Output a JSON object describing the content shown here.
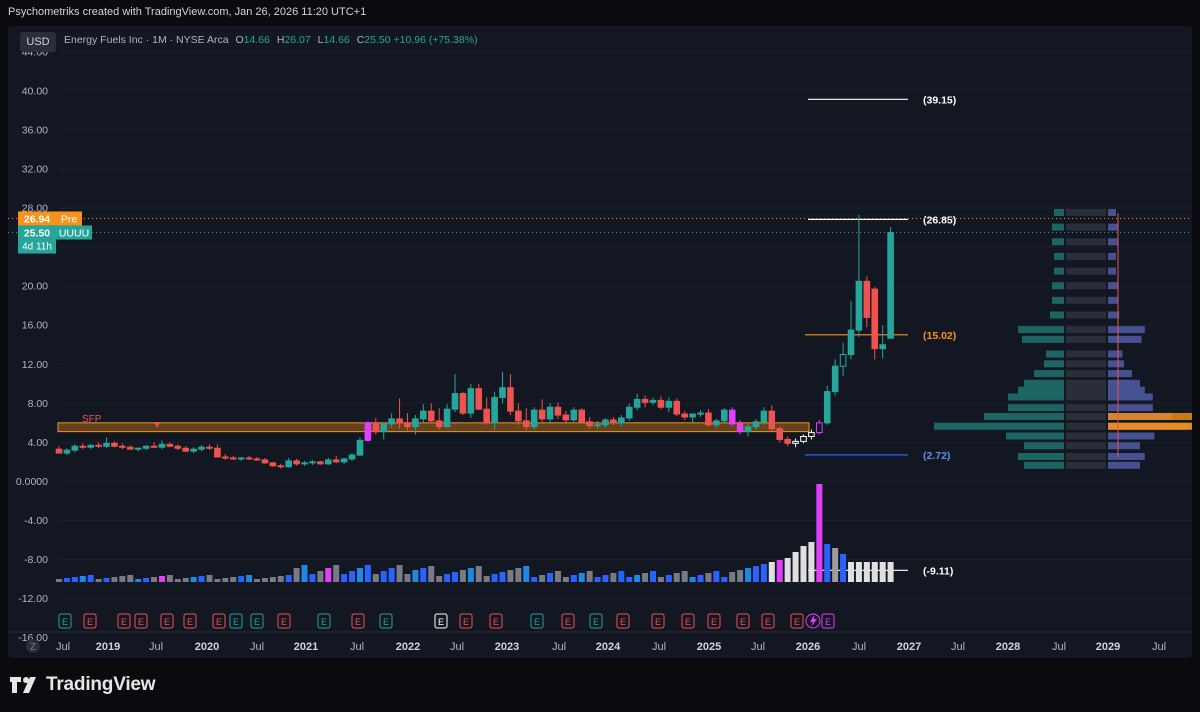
{
  "header": {
    "attribution": "Psychometriks created with TradingView.com, Jan 26, 2026 11:20 UTC+1"
  },
  "toolbar": {
    "currency": "USD"
  },
  "legend": {
    "symbol": "Energy Fuels Inc · 1M · NYSE Arca",
    "o_label": "O",
    "o_value": "14.66",
    "h_label": "H",
    "h_value": "26.07",
    "l_label": "L",
    "l_value": "14.66",
    "c_label": "C",
    "c_value": "25.50",
    "change": "+10.96 (+75.38%)"
  },
  "price_tags": [
    {
      "value": "26.94",
      "label": "Pre",
      "color": "#f7931a"
    },
    {
      "value": "25.50",
      "label": "UUUU",
      "color": "#26a69a",
      "sub": "4d 11h"
    }
  ],
  "zone_label": "SFP",
  "levels": [
    {
      "label": "(39.15)",
      "value": 39.15,
      "color": "#ffffff"
    },
    {
      "label": "(26.85)",
      "value": 26.85,
      "color": "#ffffff"
    },
    {
      "label": "(15.02)",
      "value": 15.02,
      "color": "#f7931a"
    },
    {
      "label": "(2.72)",
      "value": 2.72,
      "color": "#2962ff"
    },
    {
      "label": "(-9.11)",
      "value": -9.11,
      "color": "#ffffff"
    }
  ],
  "earnings_markers": [
    "E",
    "E",
    "E",
    "E",
    "E",
    "E",
    "E",
    "E",
    "E",
    "E",
    "E",
    "E",
    "E",
    "E",
    "E",
    "E",
    "E",
    "E",
    "E",
    "E",
    "E",
    "E",
    "E",
    "E",
    "E",
    "E",
    "E",
    "E",
    "E",
    "E",
    "E",
    "E"
  ],
  "footer": {
    "zoom_label": "Z",
    "brand": "TradingView"
  },
  "colors": {
    "up": "#26a69a",
    "down": "#ef5350",
    "background": "#131722",
    "zone": "#f7931a",
    "magenta": "#e040fb"
  },
  "chart_data": {
    "type": "candlestick",
    "title": "Energy Fuels Inc · 1M · NYSE Arca",
    "y_axis_ticks": [
      "44.00",
      "40.00",
      "36.00",
      "32.00",
      "28.00",
      "24.00",
      "20.00",
      "16.00",
      "12.00",
      "8.00",
      "4.00",
      "0.0000",
      "-4.00",
      "-8.00",
      "-12.00",
      "-16.00"
    ],
    "ylim": [
      -16,
      44
    ],
    "x_axis_ticks": [
      "Jul",
      "2019",
      "Jul",
      "2020",
      "Jul",
      "2021",
      "Jul",
      "2022",
      "Jul",
      "2023",
      "Jul",
      "2024",
      "Jul",
      "2025",
      "Jul",
      "2026",
      "Jul",
      "2027",
      "Jul",
      "2028",
      "Jul",
      "2029",
      "Jul"
    ],
    "candles": [
      {
        "o": 3.3,
        "h": 3.6,
        "l": 3.0,
        "c": 2.9
      },
      {
        "o": 2.9,
        "h": 3.4,
        "l": 2.7,
        "c": 3.2
      },
      {
        "o": 3.2,
        "h": 3.8,
        "l": 3.0,
        "c": 3.6
      },
      {
        "o": 3.6,
        "h": 3.9,
        "l": 3.3,
        "c": 3.5
      },
      {
        "o": 3.5,
        "h": 3.8,
        "l": 3.3,
        "c": 3.7
      },
      {
        "o": 3.7,
        "h": 4.0,
        "l": 3.4,
        "c": 3.6
      },
      {
        "o": 3.6,
        "h": 4.5,
        "l": 3.4,
        "c": 3.9
      },
      {
        "o": 3.9,
        "h": 4.1,
        "l": 3.5,
        "c": 3.6
      },
      {
        "o": 3.6,
        "h": 3.9,
        "l": 3.3,
        "c": 3.5
      },
      {
        "o": 3.5,
        "h": 3.7,
        "l": 3.3,
        "c": 3.3
      },
      {
        "o": 3.3,
        "h": 3.5,
        "l": 3.1,
        "c": 3.4
      },
      {
        "o": 3.4,
        "h": 3.7,
        "l": 3.2,
        "c": 3.6
      },
      {
        "o": 3.6,
        "h": 4.0,
        "l": 3.4,
        "c": 3.5
      },
      {
        "o": 3.5,
        "h": 4.2,
        "l": 3.3,
        "c": 3.8
      },
      {
        "o": 3.8,
        "h": 4.0,
        "l": 3.5,
        "c": 3.6
      },
      {
        "o": 3.6,
        "h": 3.8,
        "l": 3.2,
        "c": 3.4
      },
      {
        "o": 3.4,
        "h": 3.6,
        "l": 3.0,
        "c": 3.1
      },
      {
        "o": 3.1,
        "h": 3.5,
        "l": 2.9,
        "c": 3.3
      },
      {
        "o": 3.3,
        "h": 3.7,
        "l": 3.1,
        "c": 3.5
      },
      {
        "o": 3.5,
        "h": 3.8,
        "l": 3.2,
        "c": 3.4
      },
      {
        "o": 3.4,
        "h": 3.8,
        "l": 2.5,
        "c": 2.5
      },
      {
        "o": 2.5,
        "h": 2.8,
        "l": 2.2,
        "c": 2.4
      },
      {
        "o": 2.4,
        "h": 2.6,
        "l": 2.2,
        "c": 2.3
      },
      {
        "o": 2.3,
        "h": 2.5,
        "l": 2.1,
        "c": 2.4
      },
      {
        "o": 2.4,
        "h": 2.6,
        "l": 2.2,
        "c": 2.3
      },
      {
        "o": 2.3,
        "h": 2.5,
        "l": 2.1,
        "c": 2.2
      },
      {
        "o": 2.2,
        "h": 2.4,
        "l": 1.8,
        "c": 1.9
      },
      {
        "o": 1.9,
        "h": 2.0,
        "l": 1.5,
        "c": 1.6
      },
      {
        "o": 1.6,
        "h": 1.8,
        "l": 1.3,
        "c": 1.5
      },
      {
        "o": 1.5,
        "h": 2.4,
        "l": 1.4,
        "c": 2.1
      },
      {
        "o": 2.1,
        "h": 2.3,
        "l": 1.6,
        "c": 1.8
      },
      {
        "o": 1.8,
        "h": 2.1,
        "l": 1.6,
        "c": 1.9
      },
      {
        "o": 1.9,
        "h": 2.2,
        "l": 1.7,
        "c": 2.0
      },
      {
        "o": 2.0,
        "h": 2.1,
        "l": 1.7,
        "c": 1.8
      },
      {
        "o": 1.8,
        "h": 2.4,
        "l": 1.7,
        "c": 2.2
      },
      {
        "o": 2.2,
        "h": 2.6,
        "l": 1.9,
        "c": 2.0
      },
      {
        "o": 2.0,
        "h": 2.4,
        "l": 1.8,
        "c": 2.3
      },
      {
        "o": 2.3,
        "h": 2.9,
        "l": 2.1,
        "c": 2.7
      },
      {
        "o": 2.7,
        "h": 4.5,
        "l": 2.6,
        "c": 4.2
      },
      {
        "o": 4.2,
        "h": 6.2,
        "l": 4.1,
        "c": 6.0
      },
      {
        "o": 6.0,
        "h": 6.5,
        "l": 4.8,
        "c": 5.1
      },
      {
        "o": 5.1,
        "h": 6.0,
        "l": 4.3,
        "c": 5.9
      },
      {
        "o": 5.9,
        "h": 7.0,
        "l": 5.5,
        "c": 6.4
      },
      {
        "o": 6.4,
        "h": 8.5,
        "l": 5.4,
        "c": 6.0
      },
      {
        "o": 6.0,
        "h": 7.0,
        "l": 5.2,
        "c": 5.6
      },
      {
        "o": 5.6,
        "h": 6.8,
        "l": 4.8,
        "c": 6.4
      },
      {
        "o": 6.4,
        "h": 7.9,
        "l": 6.0,
        "c": 7.2
      },
      {
        "o": 7.2,
        "h": 8.0,
        "l": 6.0,
        "c": 6.2
      },
      {
        "o": 6.2,
        "h": 7.5,
        "l": 5.3,
        "c": 5.6
      },
      {
        "o": 5.6,
        "h": 7.9,
        "l": 5.5,
        "c": 7.4
      },
      {
        "o": 7.4,
        "h": 11.0,
        "l": 7.1,
        "c": 9.0
      },
      {
        "o": 9.0,
        "h": 9.2,
        "l": 6.8,
        "c": 7.0
      },
      {
        "o": 7.0,
        "h": 10.0,
        "l": 6.5,
        "c": 9.5
      },
      {
        "o": 9.5,
        "h": 10.0,
        "l": 7.3,
        "c": 7.4
      },
      {
        "o": 7.4,
        "h": 8.6,
        "l": 5.8,
        "c": 6.0
      },
      {
        "o": 6.0,
        "h": 9.2,
        "l": 5.3,
        "c": 8.6
      },
      {
        "o": 8.6,
        "h": 11.2,
        "l": 8.0,
        "c": 9.6
      },
      {
        "o": 9.6,
        "h": 11.0,
        "l": 6.8,
        "c": 7.2
      },
      {
        "o": 7.2,
        "h": 8.0,
        "l": 5.8,
        "c": 6.2
      },
      {
        "o": 6.2,
        "h": 7.5,
        "l": 5.2,
        "c": 5.6
      },
      {
        "o": 5.6,
        "h": 7.6,
        "l": 5.3,
        "c": 7.3
      },
      {
        "o": 7.3,
        "h": 8.4,
        "l": 6.1,
        "c": 6.4
      },
      {
        "o": 6.4,
        "h": 8.0,
        "l": 6.0,
        "c": 7.6
      },
      {
        "o": 7.6,
        "h": 8.1,
        "l": 6.4,
        "c": 6.8
      },
      {
        "o": 6.8,
        "h": 7.2,
        "l": 6.0,
        "c": 6.3
      },
      {
        "o": 6.3,
        "h": 7.6,
        "l": 6.1,
        "c": 7.3
      },
      {
        "o": 7.3,
        "h": 7.5,
        "l": 5.9,
        "c": 6.1
      },
      {
        "o": 6.1,
        "h": 6.6,
        "l": 5.4,
        "c": 5.7
      },
      {
        "o": 5.7,
        "h": 6.2,
        "l": 5.4,
        "c": 5.8
      },
      {
        "o": 5.8,
        "h": 6.5,
        "l": 5.5,
        "c": 6.3
      },
      {
        "o": 6.3,
        "h": 6.6,
        "l": 5.8,
        "c": 6.0
      },
      {
        "o": 6.0,
        "h": 6.8,
        "l": 5.6,
        "c": 6.5
      },
      {
        "o": 6.5,
        "h": 8.0,
        "l": 6.2,
        "c": 7.6
      },
      {
        "o": 7.6,
        "h": 9.0,
        "l": 7.3,
        "c": 8.4
      },
      {
        "o": 8.4,
        "h": 8.8,
        "l": 7.6,
        "c": 8.1
      },
      {
        "o": 8.1,
        "h": 8.6,
        "l": 7.8,
        "c": 8.3
      },
      {
        "o": 8.3,
        "h": 8.7,
        "l": 7.4,
        "c": 7.6
      },
      {
        "o": 7.6,
        "h": 8.6,
        "l": 7.1,
        "c": 8.2
      },
      {
        "o": 8.2,
        "h": 8.5,
        "l": 6.7,
        "c": 6.9
      },
      {
        "o": 6.9,
        "h": 7.2,
        "l": 6.3,
        "c": 6.6
      },
      {
        "o": 6.6,
        "h": 7.0,
        "l": 6.0,
        "c": 6.9
      },
      {
        "o": 6.9,
        "h": 7.3,
        "l": 6.6,
        "c": 7.0
      },
      {
        "o": 7.0,
        "h": 7.4,
        "l": 5.6,
        "c": 5.8
      },
      {
        "o": 5.8,
        "h": 6.4,
        "l": 5.5,
        "c": 6.2
      },
      {
        "o": 6.2,
        "h": 7.5,
        "l": 6.0,
        "c": 7.3
      },
      {
        "o": 7.3,
        "h": 7.6,
        "l": 5.7,
        "c": 5.9
      },
      {
        "o": 5.9,
        "h": 6.3,
        "l": 4.8,
        "c": 5.1
      },
      {
        "o": 5.1,
        "h": 5.9,
        "l": 4.6,
        "c": 5.6
      },
      {
        "o": 5.6,
        "h": 6.4,
        "l": 5.3,
        "c": 6.1
      },
      {
        "o": 6.1,
        "h": 7.6,
        "l": 5.8,
        "c": 7.2
      },
      {
        "o": 7.2,
        "h": 7.8,
        "l": 5.2,
        "c": 5.4
      },
      {
        "o": 5.4,
        "h": 5.6,
        "l": 4.0,
        "c": 4.3
      },
      {
        "o": 4.3,
        "h": 4.6,
        "l": 3.6,
        "c": 3.9
      },
      {
        "o": 3.9,
        "h": 4.4,
        "l": 3.5,
        "c": 4.1
      },
      {
        "o": 4.1,
        "h": 4.8,
        "l": 3.9,
        "c": 4.6
      },
      {
        "o": 4.6,
        "h": 5.3,
        "l": 4.3,
        "c": 5.0
      },
      {
        "o": 5.0,
        "h": 6.3,
        "l": 4.8,
        "c": 6.0
      },
      {
        "o": 6.0,
        "h": 9.8,
        "l": 5.8,
        "c": 9.2
      },
      {
        "o": 9.2,
        "h": 12.5,
        "l": 8.8,
        "c": 11.8
      },
      {
        "o": 11.8,
        "h": 14.2,
        "l": 10.8,
        "c": 13.0
      },
      {
        "o": 13.0,
        "h": 18.5,
        "l": 12.5,
        "c": 15.5
      },
      {
        "o": 15.5,
        "h": 27.3,
        "l": 14.8,
        "c": 20.5
      },
      {
        "o": 20.5,
        "h": 21.0,
        "l": 15.8,
        "c": 16.8
      },
      {
        "o": 19.7,
        "h": 19.9,
        "l": 12.5,
        "c": 13.6
      },
      {
        "o": 13.6,
        "h": 16.0,
        "l": 12.6,
        "c": 14.0
      },
      {
        "o": 14.66,
        "h": 26.07,
        "l": 14.66,
        "c": 25.5
      }
    ],
    "volume_note": "volume histogram shown in lower pane",
    "zone": {
      "from": 5.1,
      "to": 6.0,
      "label": "SFP"
    }
  }
}
